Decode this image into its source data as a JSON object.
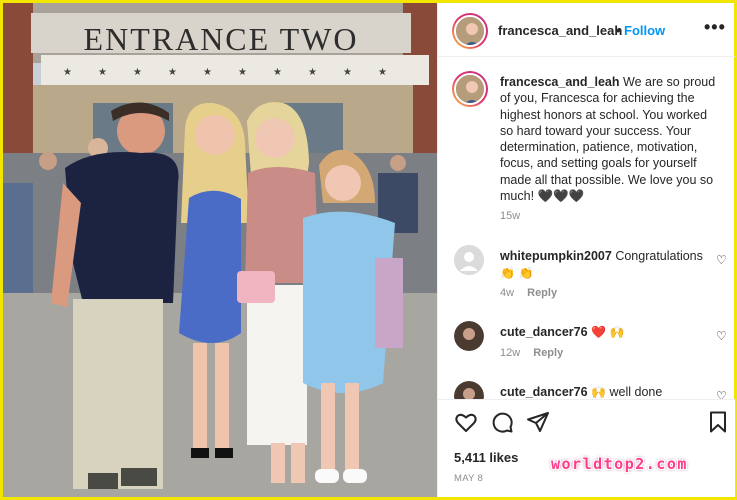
{
  "post": {
    "username": "francesca_and_leah",
    "separator": "•",
    "follow_label": "Follow",
    "more_label": "•••"
  },
  "photo": {
    "sign_text": "ENTRANCE TWO",
    "description_icon": "family-photo"
  },
  "caption": {
    "username": "francesca_and_leah",
    "text": "We are so proud of you, Francesca for achieving the highest honors at school. You worked so hard toward your success. Your determination, patience, motivation, focus, and setting goals for yourself made all that possible. We love you so much! 🖤🖤🖤",
    "time": "15w"
  },
  "comments": [
    {
      "username": "whitepumpkin2007",
      "text": "Congratulations",
      "emoji": "👏 👏",
      "time": "4w",
      "reply_label": "Reply"
    },
    {
      "username": "cute_dancer76",
      "text": "",
      "emoji": "❤️ 🙌",
      "time": "12w",
      "reply_label": "Reply"
    },
    {
      "username": "cute_dancer76",
      "text": "well done",
      "emoji": "🙌",
      "time": "",
      "reply_label": ""
    }
  ],
  "actions": {
    "likes": "5,411 likes",
    "date": "MAY 8",
    "icons": [
      "heart-icon",
      "comment-icon",
      "share-icon",
      "bookmark-icon"
    ]
  },
  "watermark": "worldtop2.com",
  "colors": {
    "follow": "#0095f6",
    "watermark": "#ff3b8a",
    "frame": "#f2e600"
  }
}
